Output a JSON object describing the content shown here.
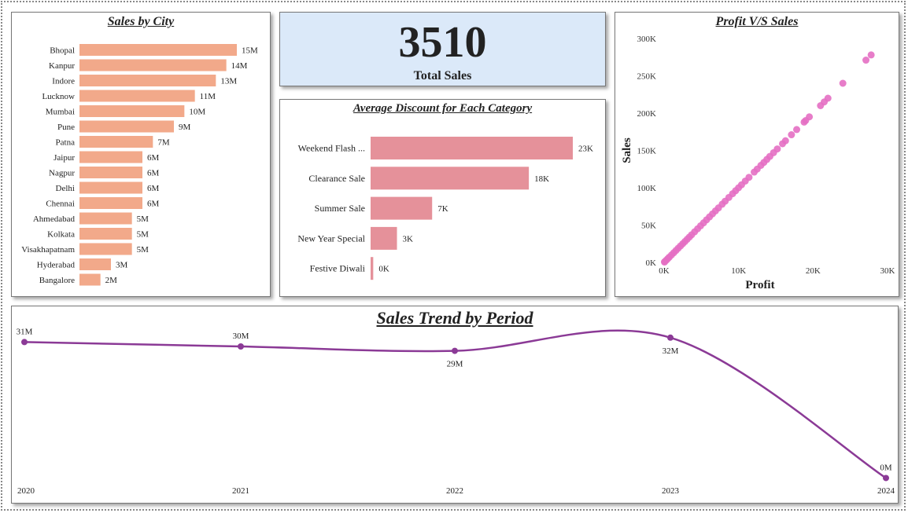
{
  "kpi": {
    "value": "3510",
    "label": "Total Sales"
  },
  "chart_data": [
    {
      "id": "city",
      "type": "bar",
      "orientation": "horizontal",
      "title": "Sales by City",
      "color": "#f2a98a",
      "categories": [
        "Bhopal",
        "Kanpur",
        "Indore",
        "Lucknow",
        "Mumbai",
        "Pune",
        "Patna",
        "Jaipur",
        "Nagpur",
        "Delhi",
        "Chennai",
        "Ahmedabad",
        "Kolkata",
        "Visakhapatnam",
        "Hyderabad",
        "Bangalore"
      ],
      "values": [
        15,
        14,
        13,
        11,
        10,
        9,
        7,
        6,
        6,
        6,
        6,
        5,
        5,
        5,
        3,
        2
      ],
      "labels": [
        "15M",
        "14M",
        "13M",
        "11M",
        "10M",
        "9M",
        "7M",
        "6M",
        "6M",
        "6M",
        "6M",
        "5M",
        "5M",
        "5M",
        "3M",
        "2M"
      ]
    },
    {
      "id": "discount",
      "type": "bar",
      "orientation": "horizontal",
      "title": "Average Discount for Each Category",
      "color": "#e5919a",
      "categories": [
        "Weekend Flash ...",
        "Clearance Sale",
        "Summer Sale",
        "New Year Special",
        "Festive Diwali"
      ],
      "values": [
        23,
        18,
        7,
        3,
        0.3
      ],
      "labels": [
        "23K",
        "18K",
        "7K",
        "3K",
        "0K"
      ]
    },
    {
      "id": "scatter",
      "type": "scatter",
      "title": "Profit V/S Sales",
      "xlabel": "Profit",
      "ylabel": "Sales",
      "color": "#e46fc3",
      "xlim": [
        0,
        30000
      ],
      "ylim": [
        0,
        300000
      ],
      "xticks": [
        "0K",
        "10K",
        "20K",
        "30K"
      ],
      "yticks": [
        "0K",
        "50K",
        "100K",
        "150K",
        "200K",
        "250K",
        "300K"
      ],
      "points": [
        [
          27800,
          278000
        ],
        [
          27100,
          271000
        ],
        [
          24000,
          240000
        ],
        [
          22000,
          220000
        ],
        [
          21500,
          215000
        ],
        [
          21000,
          210000
        ],
        [
          19500,
          195000
        ],
        [
          19000,
          190000
        ],
        [
          18800,
          188000
        ],
        [
          17800,
          178000
        ],
        [
          17100,
          171000
        ],
        [
          16300,
          163000
        ],
        [
          15900,
          159000
        ],
        [
          15200,
          152000
        ],
        [
          14700,
          147000
        ],
        [
          14200,
          142000
        ],
        [
          13800,
          138000
        ],
        [
          13400,
          134000
        ],
        [
          13000,
          130000
        ],
        [
          12500,
          125000
        ],
        [
          12100,
          121000
        ],
        [
          11400,
          114000
        ],
        [
          10900,
          109000
        ],
        [
          10400,
          104000
        ],
        [
          10000,
          100000
        ],
        [
          9600,
          96000
        ],
        [
          9200,
          92000
        ],
        [
          8700,
          87000
        ],
        [
          8200,
          82000
        ],
        [
          7800,
          78000
        ],
        [
          7300,
          73000
        ],
        [
          6900,
          69000
        ],
        [
          6500,
          65000
        ],
        [
          6100,
          61000
        ],
        [
          5700,
          57000
        ],
        [
          5300,
          53000
        ],
        [
          4900,
          49000
        ],
        [
          4500,
          45000
        ],
        [
          4100,
          41000
        ],
        [
          3700,
          37000
        ],
        [
          3400,
          34000
        ],
        [
          3100,
          31000
        ],
        [
          2800,
          28000
        ],
        [
          2500,
          25000
        ],
        [
          2200,
          22000
        ],
        [
          1900,
          19000
        ],
        [
          1600,
          16000
        ],
        [
          1300,
          13000
        ],
        [
          1000,
          10000
        ],
        [
          700,
          7000
        ],
        [
          500,
          5000
        ],
        [
          300,
          3000
        ],
        [
          100,
          1000
        ],
        [
          50,
          500
        ]
      ]
    },
    {
      "id": "trend",
      "type": "line",
      "title": "Sales Trend by Period",
      "color": "#8b3a96",
      "x": [
        "2020",
        "2021",
        "2022",
        "2023",
        "2024"
      ],
      "values": [
        31,
        30,
        29,
        32,
        0.1
      ],
      "labels": [
        "31M",
        "30M",
        "29M",
        "32M",
        "0M"
      ]
    }
  ]
}
